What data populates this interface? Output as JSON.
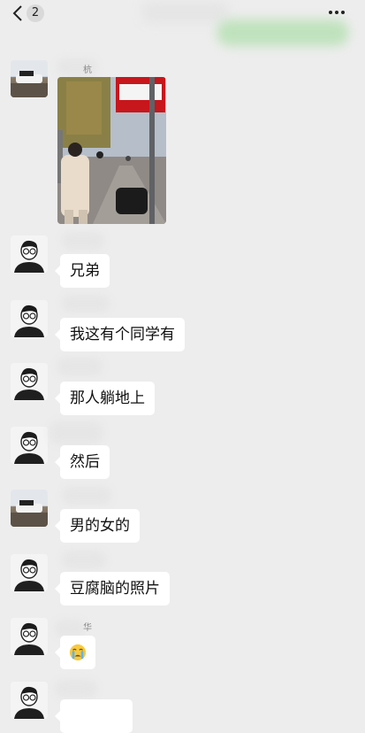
{
  "topbar": {
    "unread_count": "2"
  },
  "messages": [
    {
      "sender": "杭",
      "type": "image",
      "avatar": "car"
    },
    {
      "sender": "",
      "type": "text",
      "text": "兄弟",
      "avatar": "person"
    },
    {
      "sender": "",
      "type": "text",
      "text": "我这有个同学有",
      "avatar": "person"
    },
    {
      "sender": "",
      "type": "text",
      "text": "那人躺地上",
      "avatar": "person"
    },
    {
      "sender": "",
      "type": "text",
      "text": "然后",
      "avatar": "person"
    },
    {
      "sender": "",
      "type": "text",
      "text": "男的女的",
      "avatar": "car"
    },
    {
      "sender": "",
      "type": "text",
      "text": "豆腐脑的照片",
      "avatar": "person"
    },
    {
      "sender": "华",
      "type": "emoji",
      "emoji": "😭",
      "avatar": "person"
    },
    {
      "sender": "",
      "type": "text",
      "text": "",
      "avatar": "person"
    }
  ],
  "colors": {
    "background": "#ededed",
    "bubble": "#ffffff",
    "accent_blur": "#b7e3b4"
  }
}
